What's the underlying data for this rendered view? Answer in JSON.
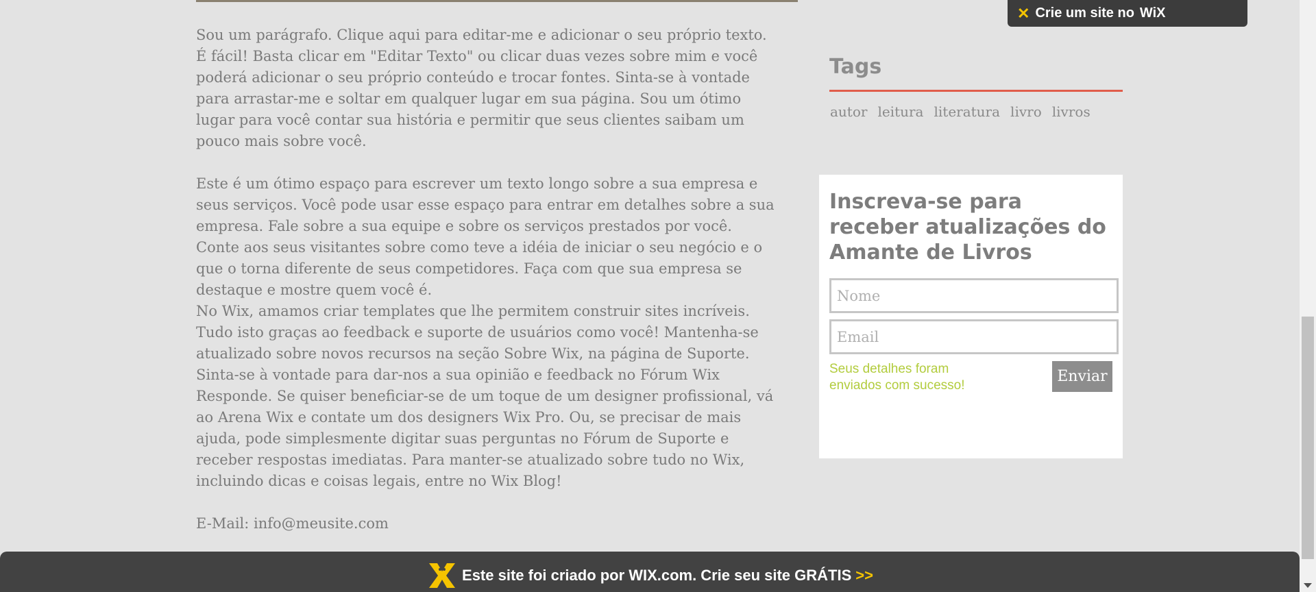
{
  "main": {
    "paragraph1": "Sou um parágrafo. Clique aqui para editar-me e adicionar o seu próprio texto. É fácil! Basta clicar em \"Editar Texto\" ou clicar duas vezes sobre mim e você poderá adicionar o seu próprio conteúdo e trocar fontes. Sinta-se à vontade para arrastar-me e soltar em qualquer lugar em sua página. Sou um ótimo lugar para você contar sua história e permitir que seus clientes saibam um pouco mais sobre você.",
    "paragraph2": "Este é um ótimo espaço para escrever um texto longo sobre a sua empresa e seus serviços. Você pode usar esse espaço para entrar em detalhes sobre a sua empresa. Fale sobre a sua equipe e sobre os serviços prestados por você. Conte aos seus visitantes sobre como teve a idéia de iniciar o seu negócio e o que o torna diferente de seus competidores. Faça com que sua empresa se destaque e mostre quem você é.",
    "paragraph3": "No Wix, amamos criar templates que lhe permitem construir sites incríveis. Tudo isto graças ao feedback e suporte de usuários como você! Mantenha-se atualizado sobre novos recursos na seção Sobre Wix, na página de Suporte. Sinta-se à vontade para dar-nos a sua opinião e feedback no Fórum Wix Responde. Se quiser beneficiar-se de um toque de um designer profissional, vá ao Arena Wix e contate um dos designers Wix Pro. Ou, se precisar de mais ajuda, pode simplesmente digitar suas perguntas no Fórum de Suporte e receber respostas imediatas. Para manter-se atualizado sobre tudo no Wix, incluindo dicas e coisas legais, entre no Wix Blog!",
    "email_line": "E-Mail: info@meusite.com"
  },
  "tags": {
    "title": "Tags",
    "items": [
      "autor",
      "leitura",
      "literatura",
      "livro",
      "livros"
    ],
    "accent_color": "#e05d4b"
  },
  "subscribe": {
    "title": "Inscreva-se para receber atualizações do Amante de Livros",
    "name_placeholder": "Nome",
    "email_placeholder": "Email",
    "success_message": "Seus detalhes foram enviados com sucesso!",
    "submit_label": "Enviar"
  },
  "wix_banner_top": {
    "text": "Crie um site no",
    "brand": "WiX",
    "icon": "wix-x-icon"
  },
  "wix_footer": {
    "text": "Este site foi criado por",
    "brand": "WIX.com.",
    "cta": "Crie seu site GRÁTIS",
    "arrows": ">>",
    "icon": "wix-mascot-icon"
  },
  "colors": {
    "background": "#e3e3e3",
    "text": "#7a7a7a",
    "success": "#b2cc3d",
    "footer": "#424242",
    "wix_yellow": "#f5c400"
  }
}
